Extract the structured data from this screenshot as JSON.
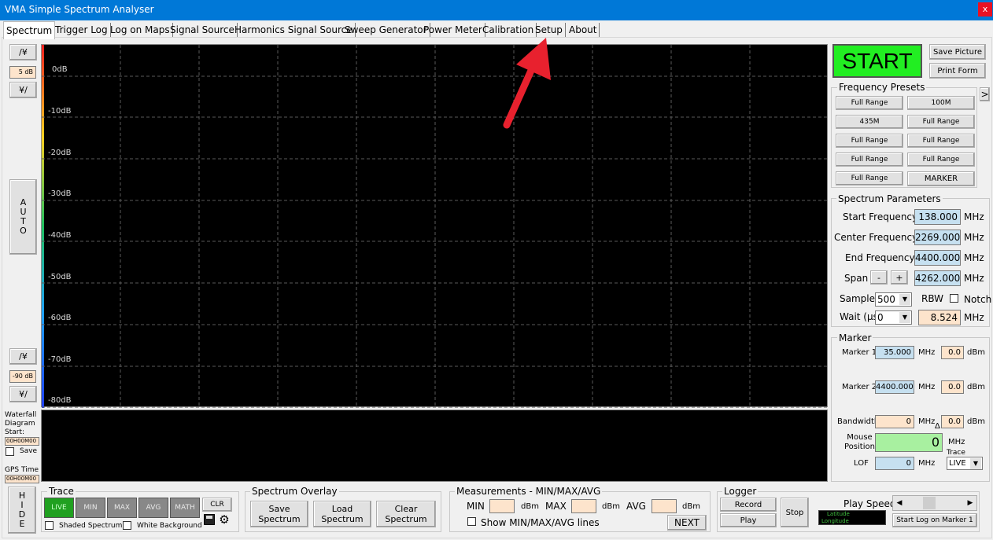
{
  "window": {
    "title": "VMA Simple Spectrum Analyser",
    "close_label": "x"
  },
  "tabs": [
    "Spectrum",
    "Trigger Log",
    "Log on Maps",
    "Signal Source",
    "Harmonics Signal Source",
    "Sweep Generator",
    "Power Meter",
    "Calibration",
    "Setup",
    "About"
  ],
  "active_tab": "Spectrum",
  "left_panel": {
    "up_label": "/¥",
    "down_label": "¥/",
    "top_db": "5 dB",
    "bottom_db": "-90 dB",
    "auto_label": [
      "A",
      "U",
      "T",
      "O"
    ],
    "waterfall_label": [
      "Waterfall",
      "Diagram",
      "Start:"
    ],
    "waterfall_time": "00H00M00",
    "save_label": "Save",
    "gps_label": "GPS Time",
    "gps_time": "00H00M00",
    "hide_label": [
      "H",
      "I",
      "D",
      "E"
    ]
  },
  "plot": {
    "db_labels": [
      "0dB",
      "-10dB",
      "-20dB",
      "-30dB",
      "-40dB",
      "-50dB",
      "-60dB",
      "-70dB",
      "-80dB"
    ],
    "colors": {
      "background": "#000000",
      "grid": "#5a5a5a",
      "arrow": "#e8212e"
    }
  },
  "right_panel": {
    "start_label": "START",
    "start_color": "#22ee22",
    "save_picture": "Save Picture",
    "print_form": "Print Form",
    "presets_title": "Frequency Presets",
    "presets_arrow": ">",
    "presets": [
      "Full Range",
      "100M",
      "435M",
      "Full Range",
      "Full Range",
      "Full Range",
      "Full Range",
      "Full Range",
      "Full Range",
      "MARKER"
    ],
    "params_title": "Spectrum Parameters",
    "start_freq_label": "Start Frequency",
    "start_freq": "138.000",
    "center_freq_label": "Center Frequency",
    "center_freq": "2269.000",
    "end_freq_label": "End Frequency",
    "end_freq": "4400.000",
    "span_label": "Span",
    "span_minus": "-",
    "span_plus": "+",
    "span": "4262.000",
    "mhz": "MHz",
    "samples_label": "Samples",
    "samples": "500",
    "rbw_label": "RBW",
    "notch_label": "Notch",
    "wait_label": "Wait (µs)",
    "wait": "0",
    "rbw_value": "8.524",
    "marker_title": "Marker",
    "marker1_label": "Marker 1",
    "marker1_freq": "35.000",
    "marker1_dbm": "0.0",
    "marker2_label": "Marker 2",
    "marker2_freq": "4400.000",
    "marker2_dbm": "0.0",
    "dbm": "dBm",
    "bandwidth_label": "Bandwidth",
    "bandwidth": "0",
    "bandwidth_dbm": "0.0",
    "delta": "Δ",
    "mouse_label": [
      "Mouse",
      "Position"
    ],
    "mouse_value": "0",
    "trace_label": "Trace",
    "trace_value": "LIVE",
    "lof_label": "LOF",
    "lof_value": "0"
  },
  "bottom": {
    "trace_title": "Trace",
    "trace_buttons": [
      "LIVE",
      "MIN",
      "MAX",
      "AVG",
      "MATH"
    ],
    "clr_label": "CLR",
    "shaded_label": "Shaded Spectrum",
    "white_bg_label": "White Background",
    "overlay_title": "Spectrum Overlay",
    "save_spectrum": [
      "Save",
      "Spectrum"
    ],
    "load_spectrum": [
      "Load",
      "Spectrum"
    ],
    "clear_spectrum": [
      "Clear",
      "Spectrum"
    ],
    "meas_title": "Measurements - MIN/MAX/AVG",
    "min_label": "MIN",
    "max_label": "MAX",
    "avg_label": "AVG",
    "dbm": "dBm",
    "show_minmax": "Show MIN/MAX/AVG lines",
    "next_label": "NEXT",
    "logger_title": "Logger",
    "record_label": "Record",
    "play_label": "Play",
    "stop_label": "Stop",
    "play_speed_label": "Play Speed",
    "latitude_label": "Latitude",
    "longitude_label": "Longitude",
    "start_log_label": "Start Log on Marker 1"
  }
}
